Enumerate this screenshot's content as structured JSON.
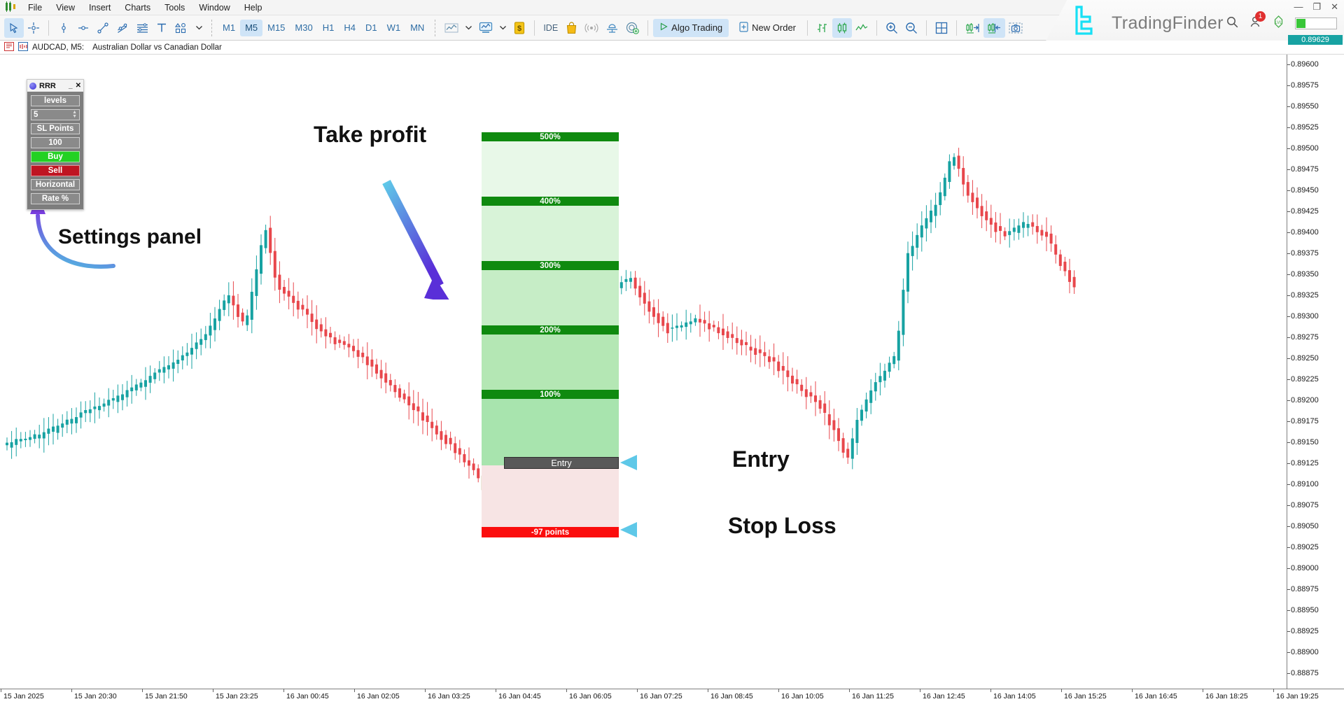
{
  "window": {
    "controls": [
      "—",
      "❐",
      "✕"
    ],
    "brand_name": "TradingFinder",
    "notification_count": "1"
  },
  "menu": {
    "items": [
      "File",
      "View",
      "Insert",
      "Charts",
      "Tools",
      "Window",
      "Help"
    ]
  },
  "toolbar": {
    "timeframes": [
      "M1",
      "M5",
      "M15",
      "M30",
      "H1",
      "H4",
      "D1",
      "W1",
      "MN"
    ],
    "selected_timeframe": "M5",
    "ide_label": "IDE",
    "algo_trading_label": "Algo Trading",
    "new_order_label": "New Order",
    "icons": [
      "cursor-icon",
      "crosshair-icon",
      "vertical-line-icon",
      "horizontal-line-icon",
      "trendline-icon",
      "channel-icon",
      "fibonacci-icon",
      "text-icon",
      "shapes-icon"
    ]
  },
  "symbol": {
    "pair_timeframe": "AUDCAD, M5:",
    "description": "Australian Dollar vs Canadian Dollar"
  },
  "rrr_panel": {
    "title": "RRR",
    "minimize": "_",
    "close": "✕",
    "levels_label": "levels",
    "levels_value": "5",
    "sl_points_label": "SL Points",
    "sl_points_value": "100",
    "buy_label": "Buy",
    "sell_label": "Sell",
    "horizontal_label": "Horizontal",
    "rate_label": "Rate %",
    "buy_color": "#23d123",
    "sell_color": "#bf1522"
  },
  "annotations": [
    {
      "text": "Settings panel",
      "name": "annotation-settings-panel"
    },
    {
      "text": "Take profit",
      "name": "annotation-take-profit"
    },
    {
      "text": "Entry",
      "name": "annotation-entry"
    },
    {
      "text": "Stop Loss",
      "name": "annotation-stop-loss"
    }
  ],
  "chart_data": {
    "type": "candlestick",
    "title": "AUDCAD M5",
    "symbol": "AUDCAD",
    "timeframe": "M5",
    "current_price": "0.89629",
    "price_ticks": [
      "0.89600",
      "0.89575",
      "0.89550",
      "0.89525",
      "0.89500",
      "0.89475",
      "0.89450",
      "0.89425",
      "0.89400",
      "0.89375",
      "0.89350",
      "0.89325",
      "0.89300",
      "0.89275",
      "0.89250",
      "0.89225",
      "0.89200",
      "0.89175",
      "0.89150",
      "0.89125",
      "0.89100",
      "0.89075",
      "0.89050",
      "0.89025",
      "0.89000",
      "0.88975",
      "0.88950",
      "0.88925",
      "0.88900",
      "0.88875"
    ],
    "time_ticks": [
      "15 Jan 2025",
      "15 Jan 20:30",
      "15 Jan 21:50",
      "15 Jan 23:25",
      "16 Jan 00:45",
      "16 Jan 02:05",
      "16 Jan 03:25",
      "16 Jan 04:45",
      "16 Jan 06:05",
      "16 Jan 07:25",
      "16 Jan 08:45",
      "16 Jan 10:05",
      "16 Jan 11:25",
      "16 Jan 12:45",
      "16 Jan 14:05",
      "16 Jan 15:25",
      "16 Jan 16:45",
      "16 Jan 18:25",
      "16 Jan 19:25"
    ],
    "ylabel": "",
    "xlabel": "",
    "grid": false,
    "rrr_tool": {
      "entry_label": "Entry",
      "stop_loss_label": "-97 points",
      "target_levels": [
        "500%",
        "400%",
        "300%",
        "200%",
        "100%"
      ],
      "profit_zone_color": "#0f8a0f",
      "loss_zone_color": "#fb0d0d"
    }
  }
}
